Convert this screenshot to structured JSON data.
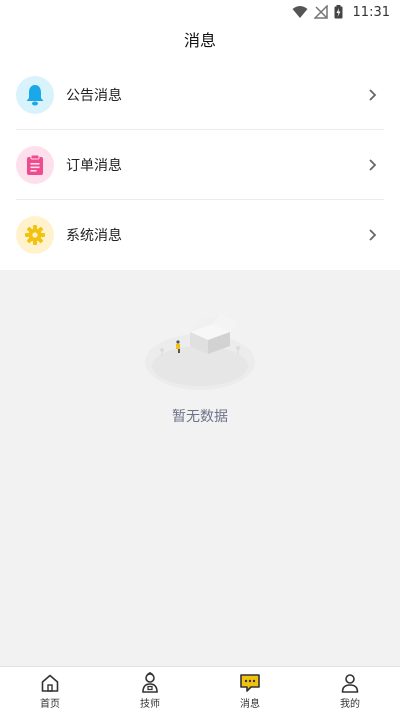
{
  "status_bar": {
    "time": "11:31"
  },
  "header": {
    "title": "消息"
  },
  "messages": [
    {
      "label": "公告消息",
      "icon": "bell-icon",
      "bg": "#d8f3fb",
      "color": "#1aa8e8"
    },
    {
      "label": "订单消息",
      "icon": "clipboard-icon",
      "bg": "#fde0ec",
      "color": "#f04b8f"
    },
    {
      "label": "系统消息",
      "icon": "gear-icon",
      "bg": "#fff2cc",
      "color": "#f3c20f"
    }
  ],
  "empty_state": {
    "text": "暂无数据"
  },
  "tabbar": {
    "active_color": "#f3c20f",
    "items": [
      {
        "label": "首页",
        "icon": "home-icon"
      },
      {
        "label": "技师",
        "icon": "technician-icon"
      },
      {
        "label": "消息",
        "icon": "message-icon",
        "active": true
      },
      {
        "label": "我的",
        "icon": "user-icon"
      }
    ]
  }
}
